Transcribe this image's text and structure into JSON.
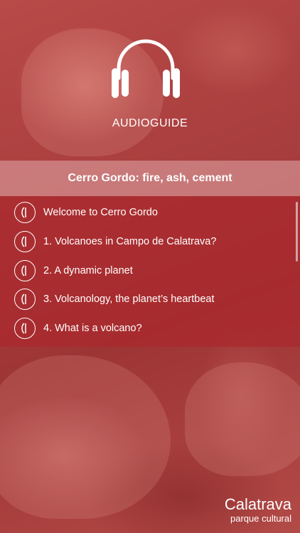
{
  "header": {
    "title": "AUDIOGUIDE",
    "icon": "headphones-icon"
  },
  "subtitle": "Cerro Gordo: fire, ash, cement",
  "tracks": [
    {
      "label": "Welcome to Cerro Gordo",
      "icon": "audio-play-icon"
    },
    {
      "label": "1. Volcanoes in Campo de Calatrava?",
      "icon": "audio-play-icon"
    },
    {
      "label": "2. A dynamic planet",
      "icon": "audio-play-icon"
    },
    {
      "label": "3. Volcanology, the planet’s heartbeat",
      "icon": "audio-play-icon"
    },
    {
      "label": "4. What is a volcano?",
      "icon": "audio-play-icon"
    }
  ],
  "brand": {
    "name": "Calatrava",
    "tagline": "parque cultural"
  },
  "colors": {
    "accent": "#b02a30",
    "band": "#e1aaaa",
    "text": "#ffffff"
  }
}
